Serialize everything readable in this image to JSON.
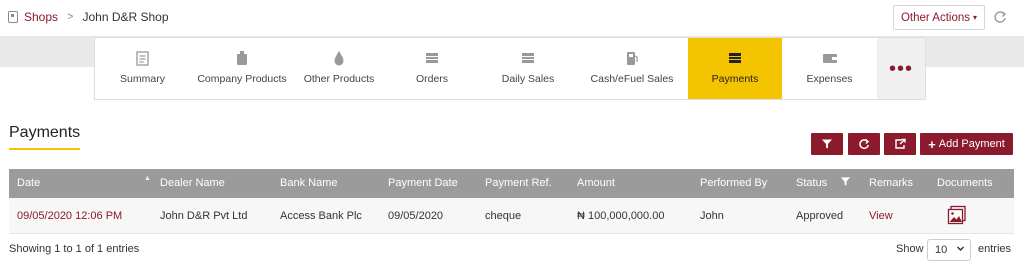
{
  "breadcrumb": {
    "root": "Shops",
    "separator": ">",
    "current": "John D&R Shop"
  },
  "header": {
    "other_actions": "Other Actions",
    "caret": "▾"
  },
  "tabs": [
    {
      "label": "Summary",
      "icon": "summary-icon"
    },
    {
      "label": "Company Products",
      "icon": "fuel-can-icon"
    },
    {
      "label": "Other Products",
      "icon": "drop-icon"
    },
    {
      "label": "Orders",
      "icon": "orders-icon"
    },
    {
      "label": "Daily Sales",
      "icon": "sales-icon"
    },
    {
      "label": "Cash/eFuel Sales",
      "icon": "pump-icon"
    },
    {
      "label": "Payments",
      "icon": "payments-icon",
      "active": true
    },
    {
      "label": "Expenses",
      "icon": "wallet-icon"
    }
  ],
  "more_tab": {
    "label": "•••"
  },
  "page": {
    "title": "Payments"
  },
  "actions": {
    "add_payment": "Add Payment",
    "plus": "+"
  },
  "table": {
    "columns": [
      "Date",
      "Dealer Name",
      "Bank Name",
      "Payment Date",
      "Payment Ref.",
      "Amount",
      "Performed By",
      "Status",
      "Remarks",
      "Documents"
    ],
    "sort_indicator": "▲",
    "rows": [
      {
        "date": "09/05/2020 12:06 PM",
        "dealer_name": "John D&R Pvt Ltd",
        "bank_name": "Access Bank Plc",
        "payment_date": "09/05/2020",
        "payment_ref": "cheque",
        "amount": "₦ 100,000,000.00",
        "performed_by": "John",
        "status": "Approved",
        "remarks": "View"
      }
    ]
  },
  "footer": {
    "showing": "Showing 1 to 1 of 1 entries",
    "show_label": "Show",
    "page_size": "10",
    "entries_label": "entries"
  },
  "colors": {
    "brand": "#8b1a2c",
    "active_tab": "#f5c400",
    "table_header": "#9b9b9b"
  }
}
